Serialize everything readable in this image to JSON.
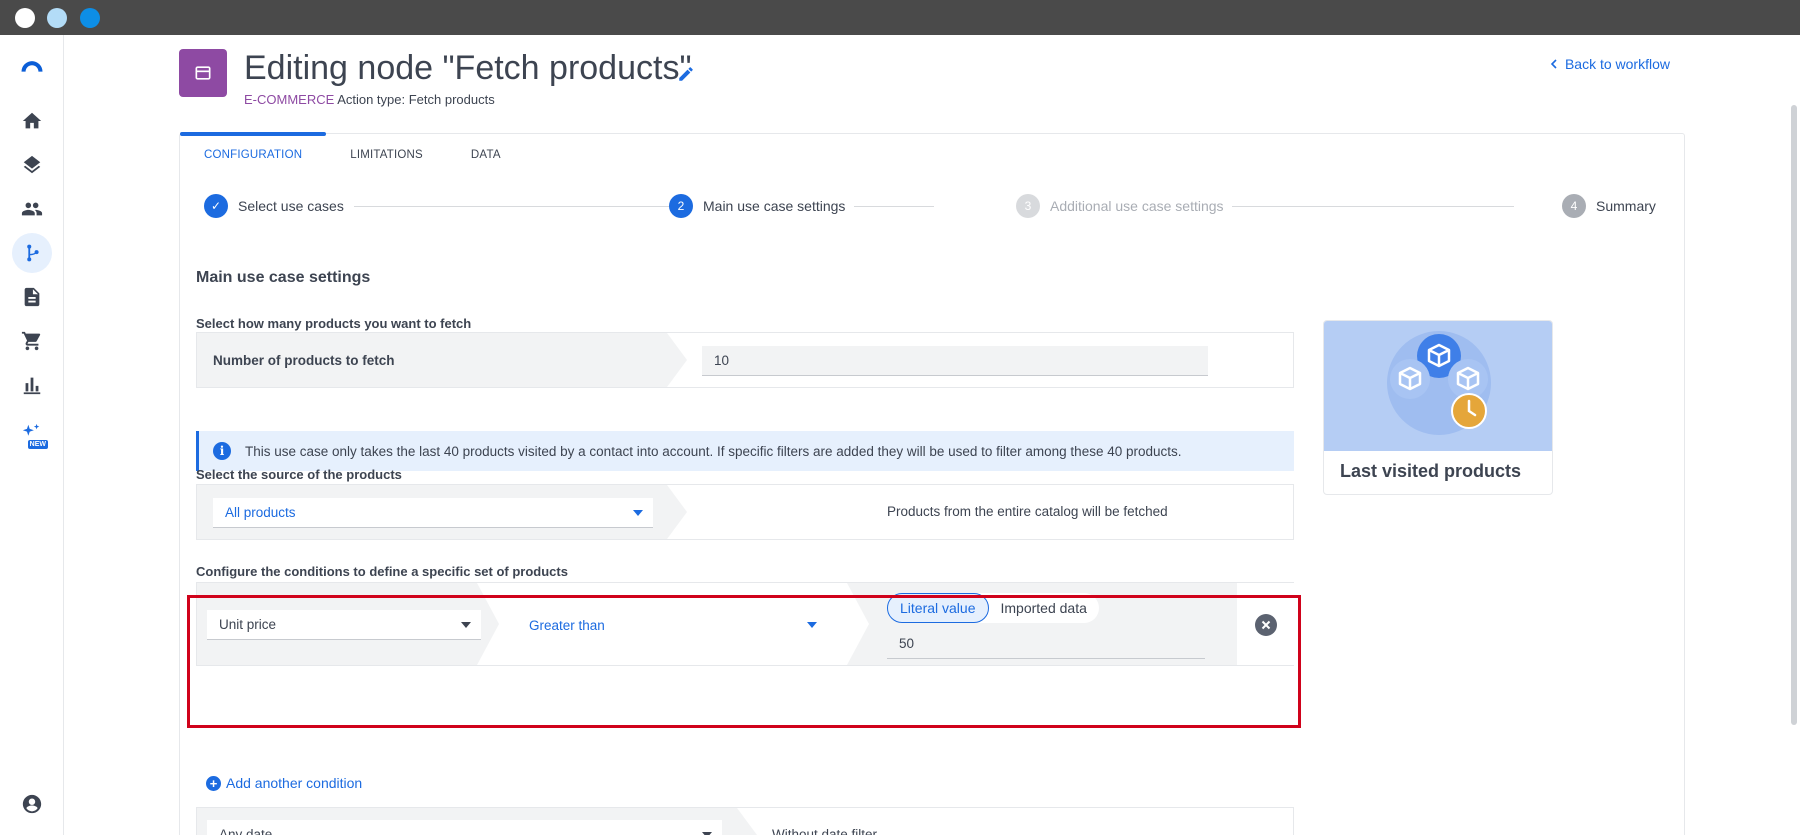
{
  "header": {
    "title": "Editing node \"Fetch products\"",
    "category": "E-COMMERCE",
    "action_type": "Action type: Fetch products",
    "back_link": "Back to workflow"
  },
  "tabs": [
    "CONFIGURATION",
    "LIMITATIONS",
    "DATA"
  ],
  "steps": [
    {
      "num": "✓",
      "label": "Select use cases"
    },
    {
      "num": "2",
      "label": "Main use case settings"
    },
    {
      "num": "3",
      "label": "Additional use case settings"
    },
    {
      "num": "4",
      "label": "Summary"
    }
  ],
  "main": {
    "section_title": "Main use case settings",
    "fetch_label": "Select how many products you want to fetch",
    "fetch_row_label": "Number of products to fetch",
    "fetch_value": "10",
    "info_text": "This use case only takes the last 40 products visited by a contact into account. If specific filters are added they will be used to filter among these 40 products.",
    "source_label": "Select the source of the products",
    "source_value": "All products",
    "source_desc": "Products from the entire catalog will be fetched",
    "conditions_label": "Configure the conditions to define a specific set of products",
    "condition": {
      "field": "Unit price",
      "operator": "Greater than",
      "toggle_literal": "Literal value",
      "toggle_imported": "Imported data",
      "value": "50"
    },
    "add_condition": "Add another condition",
    "date_select": "Any date",
    "date_desc": "Without date filter"
  },
  "use_case_card": {
    "title": "Last visited products"
  },
  "colors": {
    "accent": "#1c6be0",
    "brand_purple": "#8e4aa3",
    "highlight": "#d0021b"
  }
}
